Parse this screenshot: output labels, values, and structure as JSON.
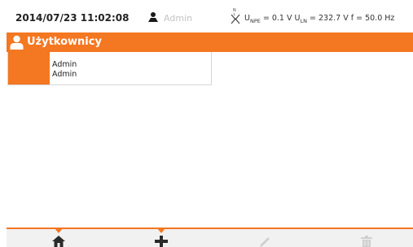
{
  "status_bar": {
    "datetime": "2014/07/23 11:02:08",
    "user": "Admin",
    "user_icon": "user-icon",
    "connector_icon": "plug-connector-icon",
    "measurements": {
      "unpe_label": "U",
      "unpe_sub": "NPE",
      "unpe_value": "= 0.1 V",
      "uln_label": "U",
      "uln_sub": "LN",
      "uln_value": "= 232.7 V",
      "freq": "f = 50.0 Hz"
    }
  },
  "header": {
    "title": "Użytkownicy",
    "icon": "user-icon"
  },
  "user_list": [
    {
      "name": "Admin",
      "role": "Admin"
    }
  ],
  "toolbar": {
    "items": [
      {
        "icon": "home-icon",
        "enabled": true
      },
      {
        "icon": "add-icon",
        "enabled": true
      },
      {
        "icon": "edit-icon",
        "enabled": false
      },
      {
        "icon": "trash-icon",
        "enabled": false
      }
    ]
  },
  "colors": {
    "accent": "#f47721",
    "disabled_icon": "#d0d0d0",
    "active_icon": "#2a2a2a"
  }
}
